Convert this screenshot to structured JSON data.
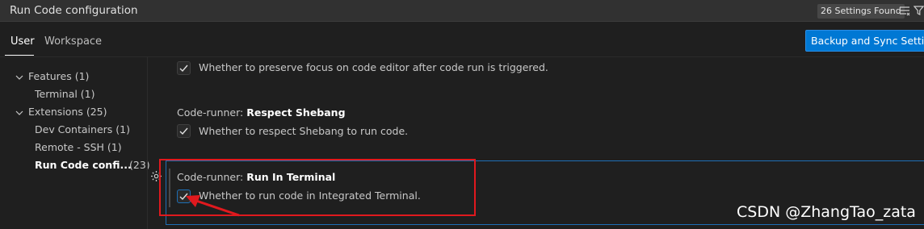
{
  "search": {
    "value": "Run Code configuration",
    "results_badge": "26 Settings Found"
  },
  "tabs": [
    {
      "label": "User",
      "active": true
    },
    {
      "label": "Workspace",
      "active": false
    }
  ],
  "backup_button": "Backup and Sync Settings",
  "toc": {
    "features": {
      "label": "Features (1)"
    },
    "terminal": {
      "label": "Terminal (1)"
    },
    "extensions": {
      "label": "Extensions (25)"
    },
    "dev_containers": {
      "label": "Dev Containers (1)"
    },
    "remote_ssh": {
      "label": "Remote - SSH (1)"
    },
    "run_code": {
      "label": "Run Code confi...",
      "count": "(23)"
    }
  },
  "settings": [
    {
      "prefix": "",
      "name": "",
      "description": "Whether to preserve focus on code editor after code run is triggered.",
      "checked": true
    },
    {
      "prefix": "Code-runner: ",
      "name": "Respect Shebang",
      "description": "Whether to respect Shebang to run code.",
      "checked": true
    },
    {
      "prefix": "Code-runner: ",
      "name": "Run In Terminal",
      "description": "Whether to run code in Integrated Terminal.",
      "checked": true
    }
  ],
  "watermark": "CSDN @ZhangTao_zata",
  "icons": {
    "clear_filter": "list-filter-icon",
    "filter": "funnel-icon",
    "settings_gear": "gear-icon",
    "check": "checkmark-icon"
  },
  "colors": {
    "accent": "#0078d4",
    "annotation": "#e0191e",
    "background": "#1f1f1f"
  }
}
